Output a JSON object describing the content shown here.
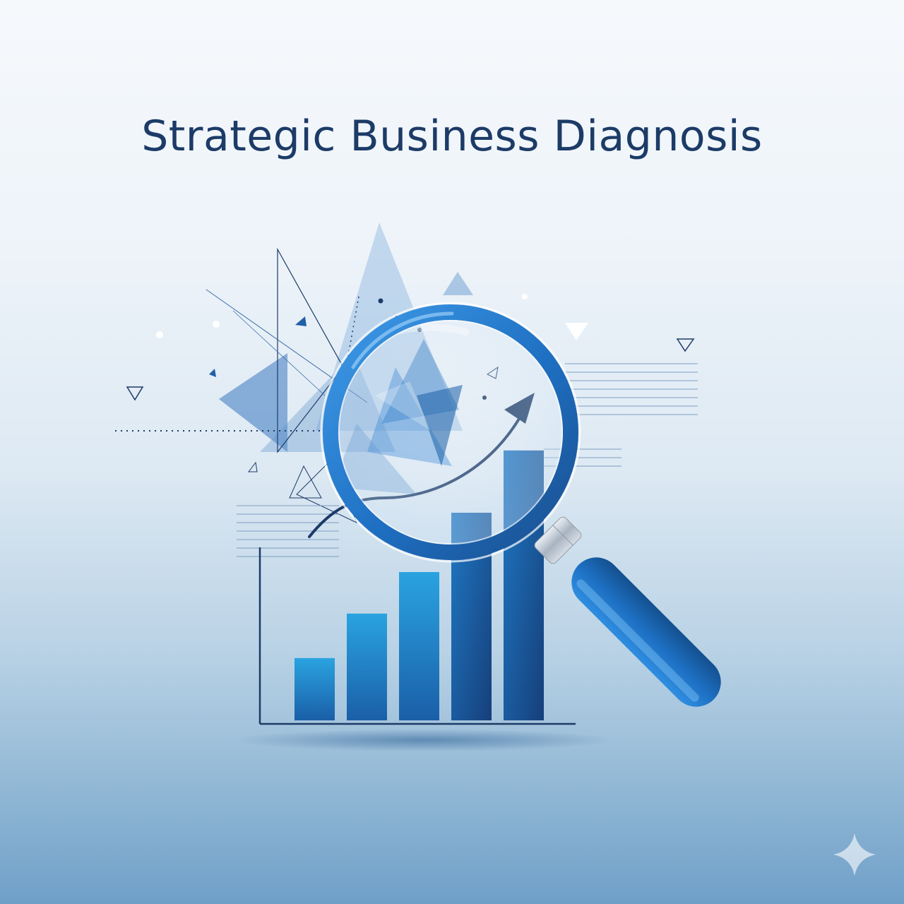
{
  "title": "Strategic Business Diagnosis",
  "colors": {
    "title": "#1c3b67",
    "primary_blue": "#1f6fbf",
    "dark_blue": "#1a4f8c",
    "light_blue": "#2aa3e0",
    "lens_ring": "#1e73c8",
    "triangle_fill": "#5b93cc",
    "background_top": "#f6f9fc",
    "background_bottom": "#6f9fc8"
  },
  "illustration": {
    "subject": "magnifying-glass-over-bar-chart",
    "bar_count": 5,
    "bar_levels": [
      0.21,
      0.36,
      0.5,
      0.7,
      0.91
    ],
    "trend": "upward-arrow",
    "decorations": [
      "translucent-triangles",
      "dotted-lines",
      "hatch-lines",
      "small-triangle-outlines",
      "dots"
    ]
  },
  "corner_mark": "sparkle-icon"
}
